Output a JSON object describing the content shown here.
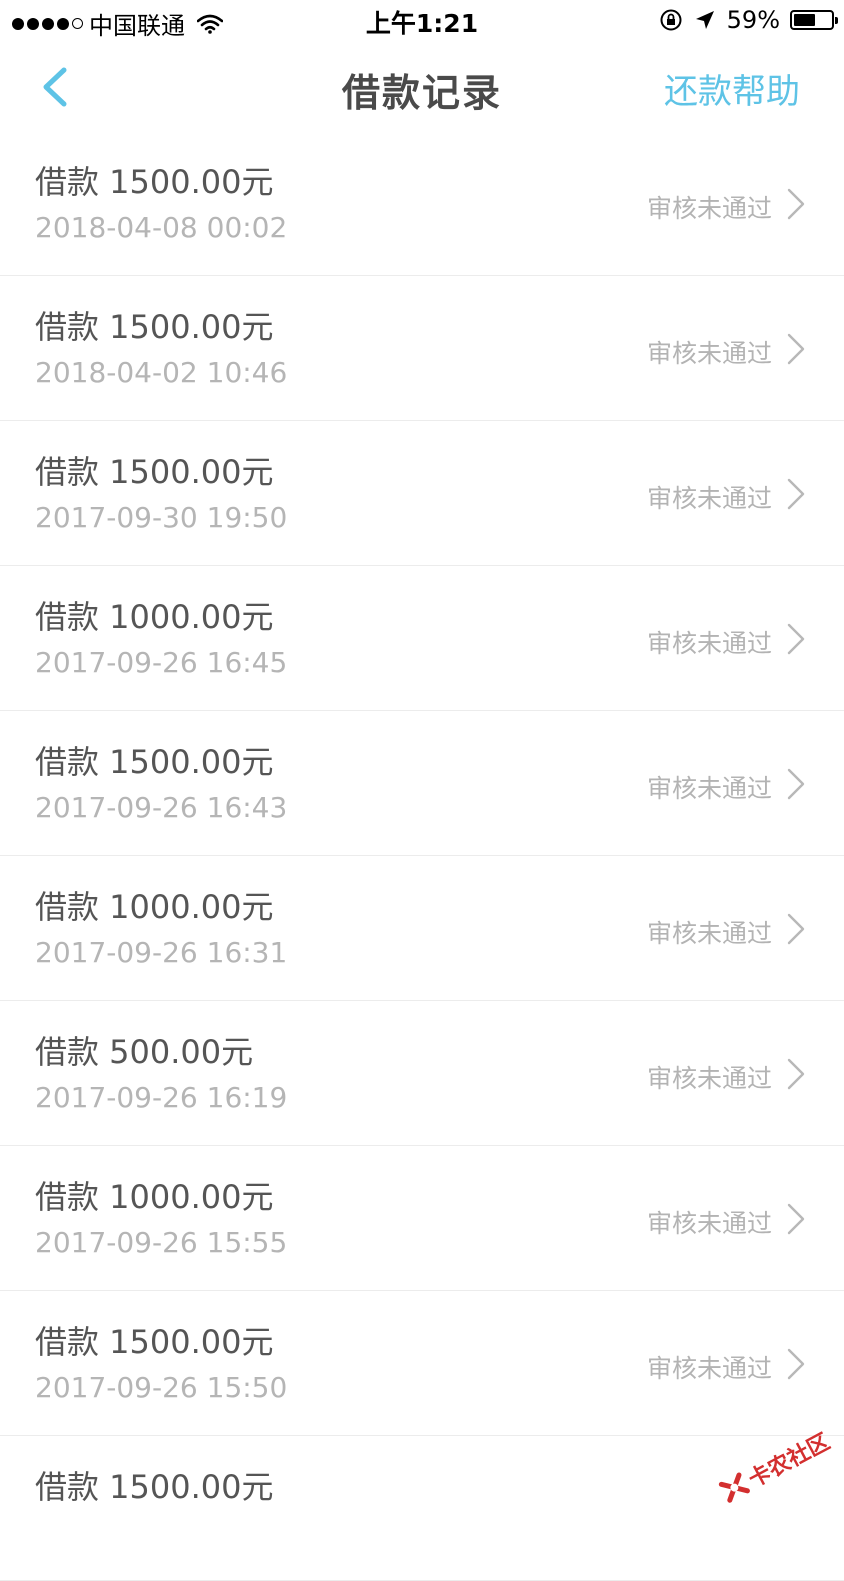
{
  "status_bar": {
    "carrier": "中国联通",
    "time": "上午1:21",
    "battery": "59%",
    "battery_level": 0.59,
    "icons": [
      "signal-dots",
      "wifi-icon",
      "rotation-lock-icon",
      "location-arrow-icon",
      "battery-icon"
    ]
  },
  "nav": {
    "back_icon": "chevron-left-icon",
    "title": "借款记录",
    "help": "还款帮助",
    "accent_color": "#5ec3e6"
  },
  "records": [
    {
      "amount": "借款 1500.00元",
      "date": "2018-04-08 00:02",
      "status": "审核未通过"
    },
    {
      "amount": "借款 1500.00元",
      "date": "2018-04-02 10:46",
      "status": "审核未通过"
    },
    {
      "amount": "借款 1500.00元",
      "date": "2017-09-30 19:50",
      "status": "审核未通过"
    },
    {
      "amount": "借款 1000.00元",
      "date": "2017-09-26 16:45",
      "status": "审核未通过"
    },
    {
      "amount": "借款 1500.00元",
      "date": "2017-09-26 16:43",
      "status": "审核未通过"
    },
    {
      "amount": "借款 1000.00元",
      "date": "2017-09-26 16:31",
      "status": "审核未通过"
    },
    {
      "amount": "借款 500.00元",
      "date": "2017-09-26 16:19",
      "status": "审核未通过"
    },
    {
      "amount": "借款 1000.00元",
      "date": "2017-09-26 15:55",
      "status": "审核未通过"
    },
    {
      "amount": "借款 1500.00元",
      "date": "2017-09-26 15:50",
      "status": "审核未通过"
    },
    {
      "amount": "借款 1500.00元",
      "date": "",
      "status": ""
    }
  ],
  "watermark": {
    "text": "卡农社区",
    "color": "#d32f2f"
  }
}
